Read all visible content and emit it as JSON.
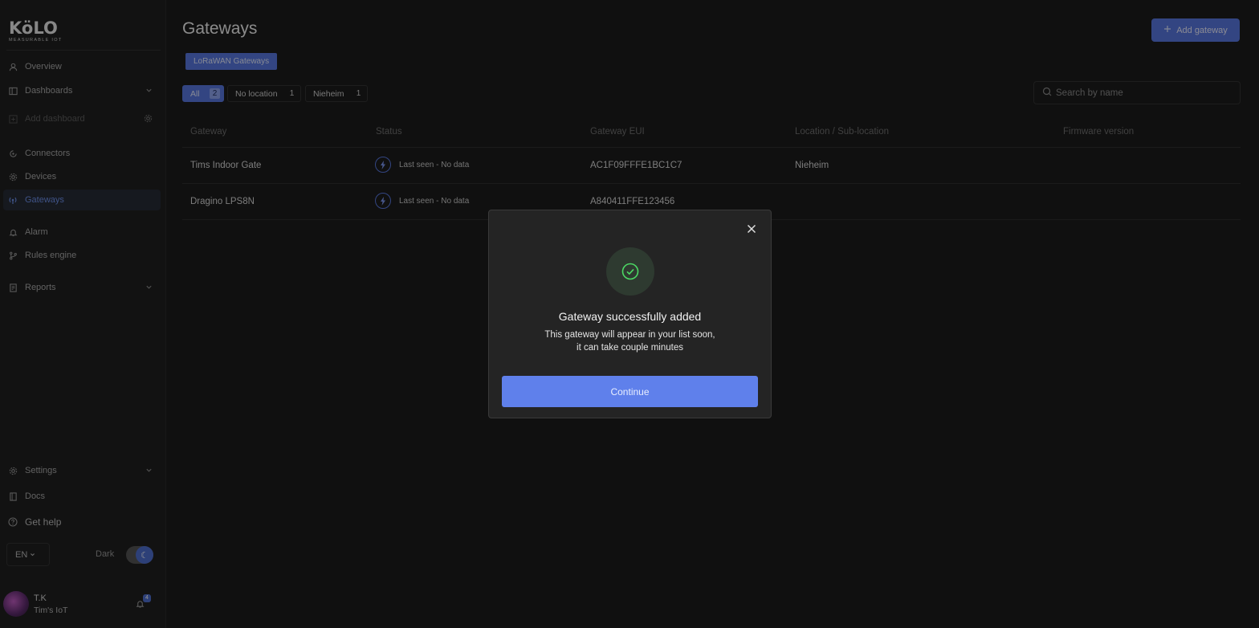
{
  "brand": {
    "logo": "KöLO",
    "tagline": "MEASURABLE IOT"
  },
  "sidebar": {
    "items": [
      {
        "label": "Overview",
        "icon": "user-icon"
      },
      {
        "label": "Dashboards",
        "icon": "dashboard-icon"
      },
      {
        "label": "Add dashboard",
        "icon": "plus-icon"
      },
      {
        "label": "Connectors",
        "icon": "connector-icon"
      },
      {
        "label": "Devices",
        "icon": "device-icon"
      },
      {
        "label": "Gateways",
        "icon": "gateway-icon"
      },
      {
        "label": "Alarm",
        "icon": "bell-icon"
      },
      {
        "label": "Rules engine",
        "icon": "branch-icon"
      },
      {
        "label": "Reports",
        "icon": "report-icon"
      },
      {
        "label": "Settings",
        "icon": "gear-icon"
      },
      {
        "label": "Docs",
        "icon": "book-icon"
      },
      {
        "label": "Get help",
        "icon": "help-icon"
      }
    ],
    "language": "EN",
    "theme_label": "Dark",
    "user": {
      "name": "T.K",
      "org": "Tim's IoT",
      "notifications": "4"
    }
  },
  "main": {
    "title": "Gateways",
    "add_button": "Add gateway",
    "type_tab": "LoRaWAN Gateways",
    "filters": [
      {
        "label": "All",
        "count": "2"
      },
      {
        "label": "No location",
        "count": "1"
      },
      {
        "label": "Nieheim",
        "count": "1"
      }
    ],
    "search_placeholder": "Search by name",
    "columns": [
      "Gateway",
      "Status",
      "Gateway EUI",
      "Location / Sub-location",
      "Firmware version"
    ],
    "rows": [
      {
        "name": "Tims Indoor Gate",
        "status": "Last seen - No data",
        "eui": "AC1F09FFFE1BC1C7",
        "location": "Nieheim",
        "firmware": ""
      },
      {
        "name": "Dragino LPS8N",
        "status": "Last seen - No data",
        "eui": "A840411FFE123456",
        "location": "",
        "firmware": ""
      }
    ]
  },
  "modal": {
    "title": "Gateway successfully added",
    "desc_line1": "This gateway will appear in your list soon,",
    "desc_line2": "it can take couple minutes",
    "button": "Continue"
  },
  "colors": {
    "accent": "#5878e0",
    "success": "#4cd964",
    "background": "#1c1c1c"
  }
}
